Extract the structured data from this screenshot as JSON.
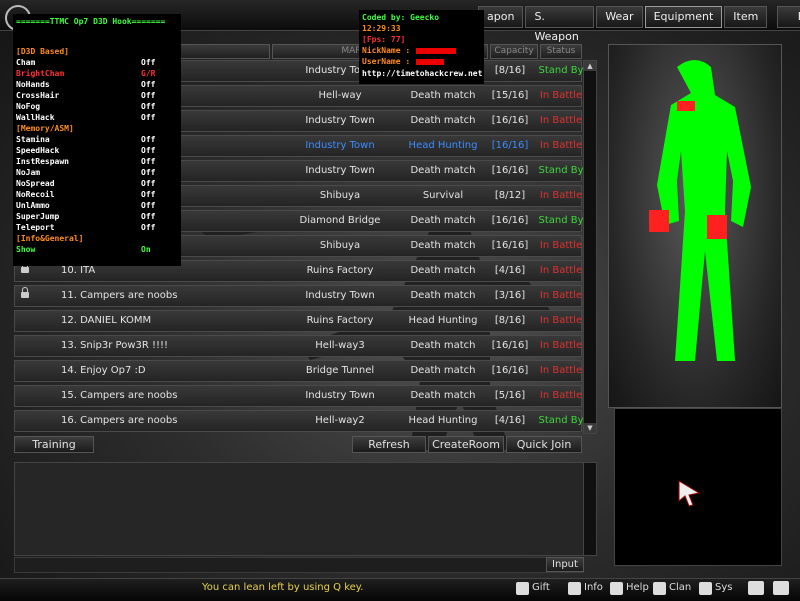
{
  "nav": [
    "apon",
    "S. Weapon",
    "Wear",
    "Equipment",
    "Item",
    "Exit"
  ],
  "columns": {
    "map": "MAP",
    "capacity": "Capacity",
    "status": "Status"
  },
  "rooms": [
    {
      "locked": false,
      "name": "",
      "map": "Industry Town",
      "mode": "",
      "capacity": "[8/16]",
      "status": "Stand By",
      "status_color": "#3cd63c",
      "blue": false
    },
    {
      "locked": false,
      "name": "",
      "map": "Hell-way",
      "mode": "Death match",
      "capacity": "[15/16]",
      "status": "In Battle",
      "status_color": "#e03030",
      "blue": false
    },
    {
      "locked": false,
      "name": "",
      "map": "Industry Town",
      "mode": "Death match",
      "capacity": "[16/16]",
      "status": "In Battle",
      "status_color": "#e03030",
      "blue": false
    },
    {
      "locked": false,
      "name": "",
      "map": "Industry Town",
      "mode": "Head Hunting",
      "capacity": "[16/16]",
      "status": "In Battle",
      "status_color": "#e03030",
      "blue": true
    },
    {
      "locked": false,
      "name": "",
      "map": "Industry Town",
      "mode": "Death match",
      "capacity": "[16/16]",
      "status": "Stand By",
      "status_color": "#3cd63c",
      "blue": false
    },
    {
      "locked": false,
      "name": "",
      "map": "Shibuya",
      "mode": "Survival",
      "capacity": "[8/12]",
      "status": "In Battle",
      "status_color": "#e03030",
      "blue": false
    },
    {
      "locked": false,
      "name": "",
      "map": "Diamond Bridge",
      "mode": "Death match",
      "capacity": "[16/16]",
      "status": "Stand By",
      "status_color": "#3cd63c",
      "blue": false
    },
    {
      "locked": false,
      "name": "",
      "map": "Shibuya",
      "mode": "Death match",
      "capacity": "[16/16]",
      "status": "In Battle",
      "status_color": "#e03030",
      "blue": false
    },
    {
      "locked": true,
      "name": "10. ITA",
      "map": "Ruins Factory",
      "mode": "Death match",
      "capacity": "[4/16]",
      "status": "In Battle",
      "status_color": "#e03030",
      "blue": false
    },
    {
      "locked": true,
      "name": "11. Campers are noobs",
      "map": "Industry Town",
      "mode": "Death match",
      "capacity": "[3/16]",
      "status": "In Battle",
      "status_color": "#e03030",
      "blue": false
    },
    {
      "locked": false,
      "name": "12. DANIEL KOMM",
      "map": "Ruins Factory",
      "mode": "Head Hunting",
      "capacity": "[8/16]",
      "status": "In Battle",
      "status_color": "#e03030",
      "blue": false
    },
    {
      "locked": false,
      "name": "13. Snip3r Pow3R !!!!",
      "map": "Hell-way3",
      "mode": "Death match",
      "capacity": "[16/16]",
      "status": "In Battle",
      "status_color": "#e03030",
      "blue": false
    },
    {
      "locked": false,
      "name": "14. Enjoy Op7 :D",
      "map": "Bridge Tunnel",
      "mode": "Death match",
      "capacity": "[16/16]",
      "status": "In Battle",
      "status_color": "#e03030",
      "blue": false
    },
    {
      "locked": false,
      "name": "15. Campers are noobs",
      "map": "Industry Town",
      "mode": "Death match",
      "capacity": "[5/16]",
      "status": "In Battle",
      "status_color": "#e03030",
      "blue": false
    },
    {
      "locked": false,
      "name": "16. Campers are noobs",
      "map": "Hell-way2",
      "mode": "Head Hunting",
      "capacity": "[4/16]",
      "status": "Stand By",
      "status_color": "#3cd63c",
      "blue": false
    }
  ],
  "buttons": {
    "training": "Training",
    "refresh": "Refresh",
    "create": "CreateRoom",
    "quick": "Quick Join",
    "input": "Input"
  },
  "tip": "You can lean left by using Q key.",
  "bottom": [
    "Gift",
    "Info",
    "Help",
    "Clan",
    "Sys"
  ],
  "hack": {
    "title": "=======TTMC Op7 D3D Hook=======",
    "items": [
      {
        "label": "[D3D Based]",
        "value": "",
        "color": "#ff8c1a"
      },
      {
        "label": "Cham",
        "value": "Off",
        "color": "#ffffff"
      },
      {
        "label": "BrightCham",
        "value": "G/R",
        "color": "#ff3030"
      },
      {
        "label": "NoHands",
        "value": "Off",
        "color": "#ffffff"
      },
      {
        "label": "CrossHair",
        "value": "Off",
        "color": "#ffffff"
      },
      {
        "label": "NoFog",
        "value": "Off",
        "color": "#ffffff"
      },
      {
        "label": "WallHack",
        "value": "Off",
        "color": "#ffffff"
      },
      {
        "label": "[Memory/ASM]",
        "value": "",
        "color": "#ff8c1a"
      },
      {
        "label": "Stamina",
        "value": "Off",
        "color": "#ffffff"
      },
      {
        "label": "SpeedHack",
        "value": "Off",
        "color": "#ffffff"
      },
      {
        "label": "InstRespawn",
        "value": "Off",
        "color": "#ffffff"
      },
      {
        "label": "NoJam",
        "value": "Off",
        "color": "#ffffff"
      },
      {
        "label": "NoSpread",
        "value": "Off",
        "color": "#ffffff"
      },
      {
        "label": "NoRecoil",
        "value": "Off",
        "color": "#ffffff"
      },
      {
        "label": "UnlAmmo",
        "value": "Off",
        "color": "#ffffff"
      },
      {
        "label": "SuperJump",
        "value": "Off",
        "color": "#ffffff"
      },
      {
        "label": "Teleport",
        "value": "Off",
        "color": "#ffffff"
      },
      {
        "label": "[Info&General]",
        "value": "",
        "color": "#ff8c1a"
      },
      {
        "label": "Show",
        "value": "On",
        "color": "#3cff3c"
      }
    ]
  },
  "info": {
    "coded": "Coded by: Geecko",
    "time": "12:29:33",
    "fps": "[Fps: 77]",
    "nick": "NickName :",
    "user": "UserName :",
    "url": "http://timetohackcrew.net"
  }
}
